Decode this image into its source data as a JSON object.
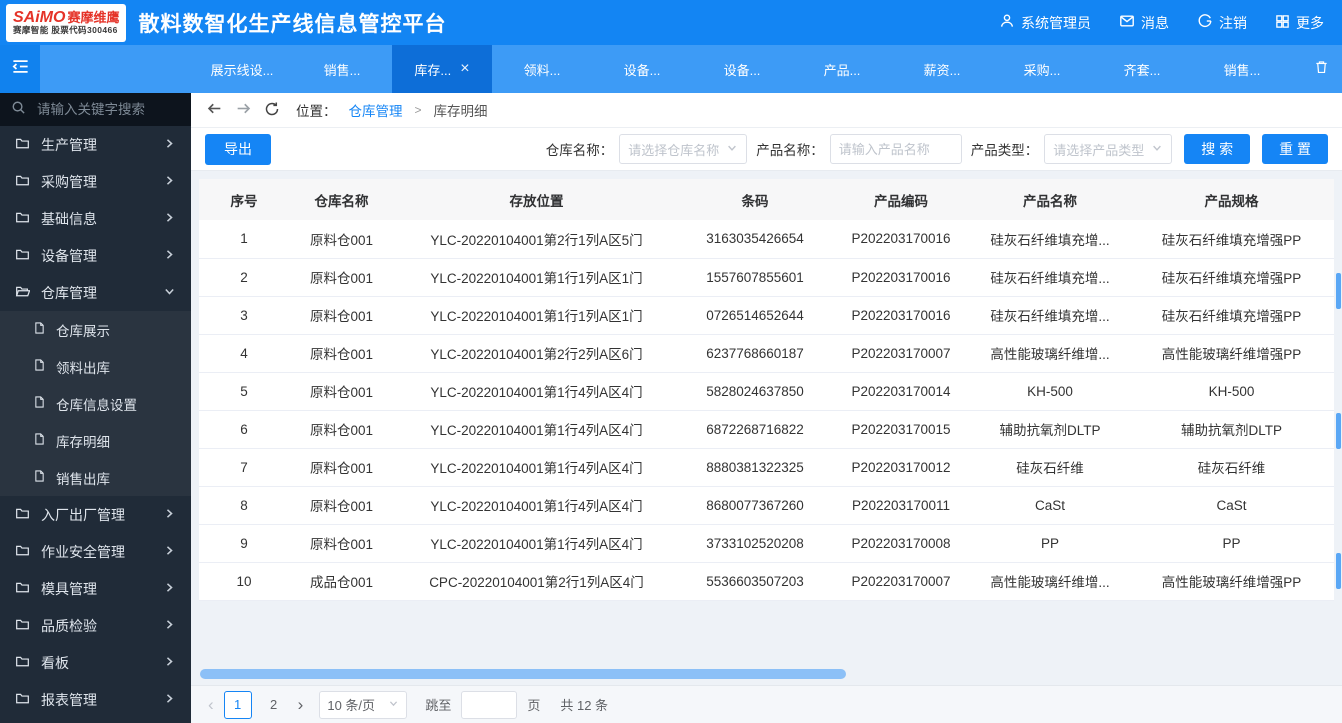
{
  "colors": {
    "accent": "#1585f5",
    "header_bg": "#1385f3",
    "tabbar_bg": "#3d9bf6",
    "tab_active_bg": "#0d6ed8",
    "hamburger_bg": "#1182ee",
    "sidebar_bg": "#202b38",
    "sidebar_search_bg": "#0d141d",
    "submenu_bg": "#2a3440",
    "content_bg": "#eef2f7"
  },
  "app": {
    "logo": {
      "brand": "SAiMO",
      "brand_suffix": "赛摩维鹰",
      "subtitle": "赛摩智能 股票代码300466"
    },
    "title": "散料数智化生产线信息管控平台",
    "user": "系统管理员",
    "messages_label": "消息",
    "logout_label": "注销",
    "more_label": "更多"
  },
  "tabs": {
    "items": [
      {
        "label": "展示线设...",
        "active": false
      },
      {
        "label": "销售...",
        "active": false
      },
      {
        "label": "库存...",
        "active": true,
        "closable": true
      },
      {
        "label": "领料...",
        "active": false
      },
      {
        "label": "设备...",
        "active": false
      },
      {
        "label": "设备...",
        "active": false
      },
      {
        "label": "产品...",
        "active": false
      },
      {
        "label": "薪资...",
        "active": false
      },
      {
        "label": "采购...",
        "active": false
      },
      {
        "label": "齐套...",
        "active": false
      },
      {
        "label": "销售...",
        "active": false
      }
    ]
  },
  "sidebar": {
    "search_placeholder": "请输入关键字搜索",
    "items": [
      {
        "label": "生产管理",
        "expanded": false
      },
      {
        "label": "采购管理",
        "expanded": false
      },
      {
        "label": "基础信息",
        "expanded": false
      },
      {
        "label": "设备管理",
        "expanded": false
      },
      {
        "label": "仓库管理",
        "expanded": true,
        "children": [
          "仓库展示",
          "领料出库",
          "仓库信息设置",
          "库存明细",
          "销售出库"
        ]
      },
      {
        "label": "入厂出厂管理",
        "expanded": false
      },
      {
        "label": "作业安全管理",
        "expanded": false
      },
      {
        "label": "模具管理",
        "expanded": false
      },
      {
        "label": "品质检验",
        "expanded": false
      },
      {
        "label": "看板",
        "expanded": false
      },
      {
        "label": "报表管理",
        "expanded": false
      }
    ]
  },
  "breadcrumb": {
    "prefix": "位置：",
    "parent": "仓库管理",
    "separator": ">",
    "current": "库存明细"
  },
  "toolbar": {
    "export_label": "导出",
    "filters": [
      {
        "label": "仓库名称：",
        "placeholder": "请选择仓库名称",
        "type": "select"
      },
      {
        "label": "产品名称：",
        "placeholder": "请输入产品名称",
        "type": "input"
      },
      {
        "label": "产品类型：",
        "placeholder": "请选择产品类型",
        "type": "select"
      }
    ],
    "search_label": "搜 索",
    "reset_label": "重 置"
  },
  "table": {
    "columns": [
      "序号",
      "仓库名称",
      "存放位置",
      "条码",
      "产品编码",
      "产品名称",
      "产品规格"
    ],
    "rows": [
      [
        "1",
        "原料仓001",
        "YLC-20220104001第2行1列A区5门",
        "3163035426654",
        "P202203170016",
        "硅灰石纤维填充增...",
        "硅灰石纤维填充增强PP"
      ],
      [
        "2",
        "原料仓001",
        "YLC-20220104001第1行1列A区1门",
        "1557607855601",
        "P202203170016",
        "硅灰石纤维填充增...",
        "硅灰石纤维填充增强PP"
      ],
      [
        "3",
        "原料仓001",
        "YLC-20220104001第1行1列A区1门",
        "0726514652644",
        "P202203170016",
        "硅灰石纤维填充增...",
        "硅灰石纤维填充增强PP"
      ],
      [
        "4",
        "原料仓001",
        "YLC-20220104001第2行2列A区6门",
        "6237768660187",
        "P202203170007",
        "高性能玻璃纤维增...",
        "高性能玻璃纤维增强PP"
      ],
      [
        "5",
        "原料仓001",
        "YLC-20220104001第1行4列A区4门",
        "5828024637850",
        "P202203170014",
        "KH-500",
        "KH-500"
      ],
      [
        "6",
        "原料仓001",
        "YLC-20220104001第1行4列A区4门",
        "6872268716822",
        "P202203170015",
        "辅助抗氧剂DLTP",
        "辅助抗氧剂DLTP"
      ],
      [
        "7",
        "原料仓001",
        "YLC-20220104001第1行4列A区4门",
        "8880381322325",
        "P202203170012",
        "硅灰石纤维",
        "硅灰石纤维"
      ],
      [
        "8",
        "原料仓001",
        "YLC-20220104001第1行4列A区4门",
        "8680077367260",
        "P202203170011",
        "CaSt",
        "CaSt"
      ],
      [
        "9",
        "原料仓001",
        "YLC-20220104001第1行4列A区4门",
        "3733102520208",
        "P202203170008",
        "PP",
        "PP"
      ],
      [
        "10",
        "成品仓001",
        "CPC-20220104001第2行1列A区4门",
        "5536603507203",
        "P202203170007",
        "高性能玻璃纤维增...",
        "高性能玻璃纤维增强PP"
      ]
    ]
  },
  "pagination": {
    "pages": [
      "1",
      "2"
    ],
    "current": "1",
    "page_size": "10 条/页",
    "jump_label": "跳至",
    "page_label": "页",
    "total": "共 12 条"
  },
  "icons": [
    "search-icon",
    "menu-fold-icon",
    "user-icon",
    "mail-icon",
    "logout-icon",
    "grid-icon",
    "trash-icon",
    "back-icon",
    "forward-icon",
    "refresh-icon",
    "folder-icon",
    "folder-open-icon",
    "file-icon",
    "chevron-right-icon",
    "chevron-down-icon",
    "close-icon"
  ]
}
